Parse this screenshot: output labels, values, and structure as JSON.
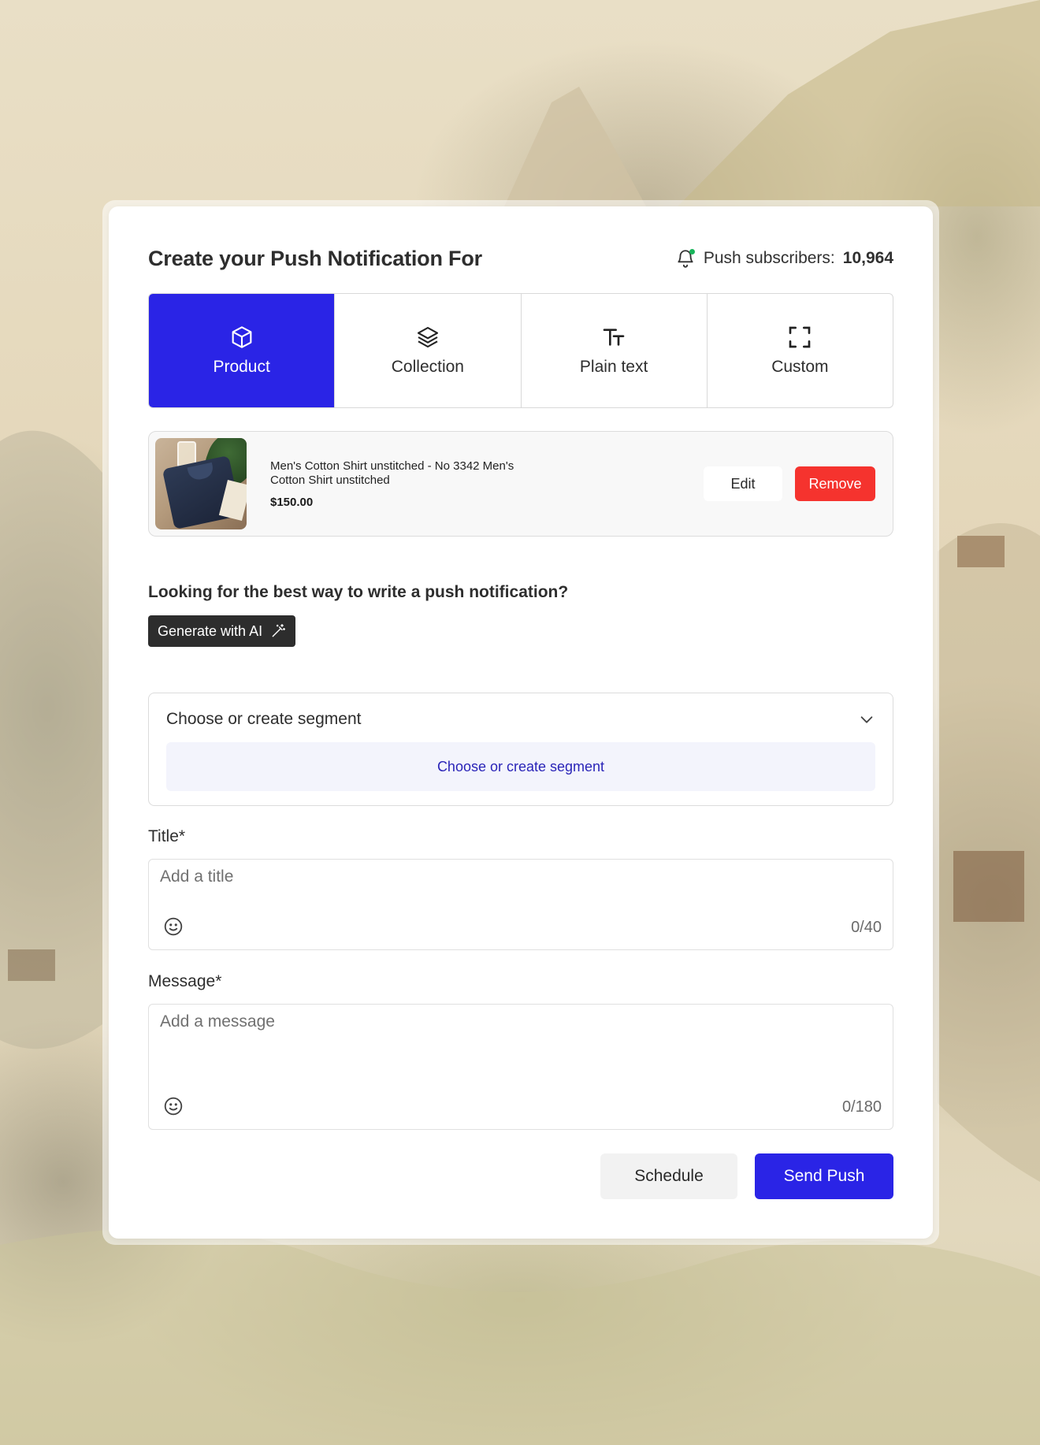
{
  "header": {
    "title": "Create your Push Notification For",
    "subscribers_label": "Push subscribers:",
    "subscribers_count": "10,964"
  },
  "tabs": [
    {
      "label": "Product",
      "icon": "cube-icon",
      "active": true
    },
    {
      "label": "Collection",
      "icon": "layers-icon",
      "active": false
    },
    {
      "label": "Plain text",
      "icon": "text-size-icon",
      "active": false
    },
    {
      "label": "Custom",
      "icon": "frame-corners-icon",
      "active": false
    }
  ],
  "product": {
    "name": "Men's Cotton Shirt unstitched - No 3342 Men's Cotton Shirt unstitched",
    "price": "$150.00",
    "edit_label": "Edit",
    "remove_label": "Remove"
  },
  "ai": {
    "question": "Looking for the best way to write a push notification?",
    "button_label": "Generate with AI"
  },
  "segment": {
    "dropdown_label": "Choose or create segment",
    "button_label": "Choose or create segment"
  },
  "title_field": {
    "label": "Title*",
    "placeholder": "Add a title",
    "counter": "0/40"
  },
  "message_field": {
    "label": "Message*",
    "placeholder": "Add a message",
    "counter": "0/180"
  },
  "actions": {
    "schedule_label": "Schedule",
    "send_label": "Send Push"
  },
  "colors": {
    "accent": "#2a24e6",
    "danger": "#f5332e",
    "dark_button": "#2d2d2d",
    "status_dot": "#18b45a"
  }
}
